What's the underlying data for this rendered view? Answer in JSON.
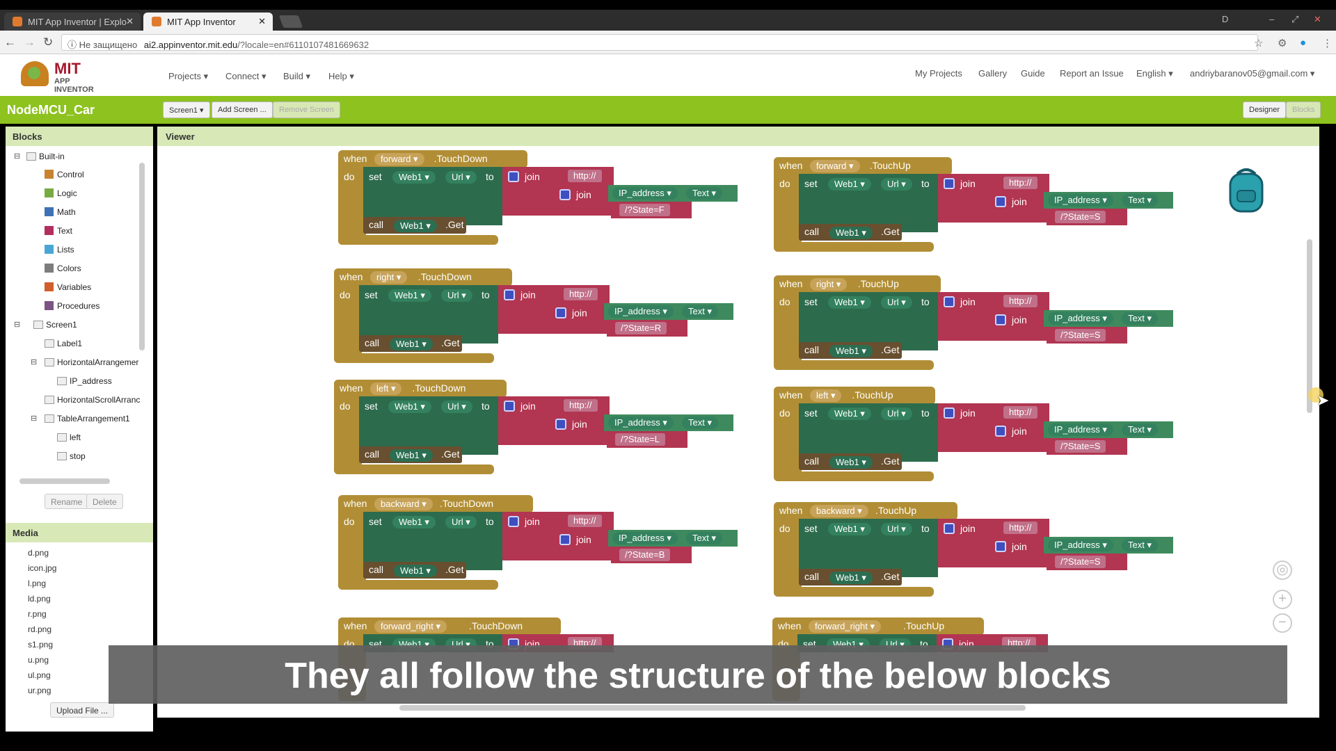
{
  "browser": {
    "tabs": [
      {
        "title": "MIT App Inventor | Explo",
        "active": false
      },
      {
        "title": "MIT App Inventor",
        "active": true
      }
    ],
    "profile_initial": "D",
    "address": {
      "security": "Не защищено",
      "domain": "ai2.appinventor.mit.edu",
      "path": "/?locale=en#6110107481669632"
    }
  },
  "header": {
    "logo_mit": "MIT",
    "logo_sub": "APP INVENTOR",
    "menus": [
      "Projects ▾",
      "Connect ▾",
      "Build ▾",
      "Help ▾"
    ],
    "right_links": [
      "My Projects",
      "Gallery",
      "Guide",
      "Report an Issue",
      "English ▾",
      "andriybaranov05@gmail.com ▾"
    ]
  },
  "project_bar": {
    "project_name": "NodeMCU_Car",
    "screen_select": "Screen1 ▾",
    "add_screen": "Add Screen ...",
    "remove_screen": "Remove Screen",
    "designer": "Designer",
    "blocks": "Blocks"
  },
  "blocks_panel": {
    "title": "Blocks",
    "builtin": "Built-in",
    "builtin_items": [
      {
        "label": "Control",
        "color": "#c88330"
      },
      {
        "label": "Logic",
        "color": "#77ab41"
      },
      {
        "label": "Math",
        "color": "#3f71b5"
      },
      {
        "label": "Text",
        "color": "#b32d5e"
      },
      {
        "label": "Lists",
        "color": "#49a6d4"
      },
      {
        "label": "Colors",
        "color": "#7d7d7d"
      },
      {
        "label": "Variables",
        "color": "#d05f2d"
      },
      {
        "label": "Procedures",
        "color": "#7c5385"
      }
    ],
    "components": [
      "Screen1",
      "Label1",
      "HorizontalArrangemer",
      "IP_address",
      "HorizontalScrollArranc",
      "TableArrangement1",
      "left",
      "stop"
    ],
    "rename": "Rename",
    "delete": "Delete"
  },
  "media": {
    "title": "Media",
    "files": [
      "d.png",
      "icon.jpg",
      "l.png",
      "ld.png",
      "r.png",
      "rd.png",
      "s1.png",
      "u.png",
      "ul.png",
      "ur.png"
    ],
    "upload": "Upload File ..."
  },
  "viewer": {
    "title": "Viewer",
    "kw": {
      "when": "when",
      "do": "do",
      "set": "set",
      "to": "to",
      "join": "join",
      "call": "call",
      "web": "Web1 ▾",
      "url": "Url ▾",
      "get": ".Get",
      "http": "http://",
      "ip": "IP_address ▾",
      "text": "Text ▾"
    },
    "down_blocks": [
      {
        "component": "forward ▾",
        "event": ".TouchDown",
        "state": "/?State=F"
      },
      {
        "component": "right ▾",
        "event": ".TouchDown",
        "state": "/?State=R"
      },
      {
        "component": "left ▾",
        "event": ".TouchDown",
        "state": "/?State=L"
      },
      {
        "component": "backward ▾",
        "event": ".TouchDown",
        "state": "/?State=B"
      },
      {
        "component": "forward_right ▾",
        "event": ".TouchDown",
        "state": ""
      }
    ],
    "up_blocks": [
      {
        "component": "forward ▾",
        "event": ".TouchUp",
        "state": "/?State=S"
      },
      {
        "component": "right ▾",
        "event": ".TouchUp",
        "state": "/?State=S"
      },
      {
        "component": "left ▾",
        "event": ".TouchUp",
        "state": "/?State=S"
      },
      {
        "component": "backward ▾",
        "event": ".TouchUp",
        "state": "/?State=S"
      },
      {
        "component": "forward_right ▾",
        "event": ".TouchUp",
        "state": ""
      }
    ]
  },
  "caption": "They all follow the structure of the below blocks"
}
